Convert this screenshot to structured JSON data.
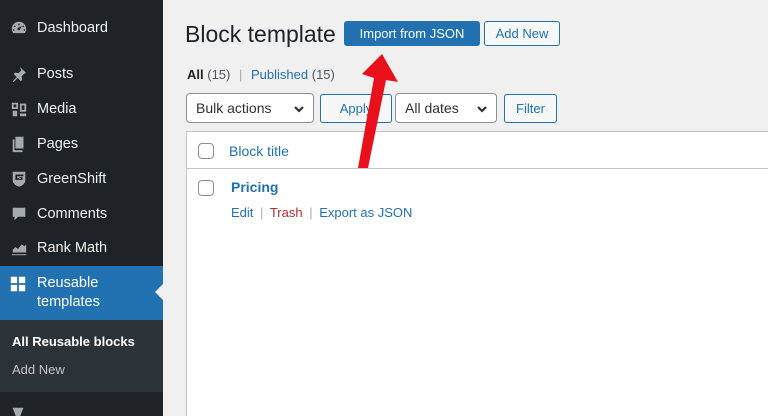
{
  "sidebar": {
    "items": [
      {
        "label": "Dashboard",
        "icon": "dashboard-icon"
      },
      {
        "label": "Posts",
        "icon": "pin-icon"
      },
      {
        "label": "Media",
        "icon": "media-icon"
      },
      {
        "label": "Pages",
        "icon": "pages-icon"
      },
      {
        "label": "GreenShift",
        "icon": "greenshift-icon"
      },
      {
        "label": "Comments",
        "icon": "comment-icon"
      },
      {
        "label": "Rank Math",
        "icon": "chart-icon"
      }
    ],
    "active": {
      "label_line1": "Reusable",
      "label_line2": "templates",
      "icon": "blocks-icon"
    },
    "submenu": {
      "current": "All Reusable blocks",
      "add_new": "Add New"
    }
  },
  "header": {
    "title": "Block template",
    "import_button": "Import from JSON",
    "add_new_button": "Add New"
  },
  "filters": {
    "all_label": "All",
    "all_count": "(15)",
    "separator": "|",
    "published_label": "Published",
    "published_count": "(15)",
    "bulk_actions": "Bulk actions",
    "apply_button": "Apply",
    "dates": "All dates",
    "filter_button": "Filter"
  },
  "table": {
    "column_title": "Block title",
    "rows": [
      {
        "title": "Pricing",
        "actions": {
          "edit": "Edit",
          "trash": "Trash",
          "export": "Export as JSON",
          "separator": "|"
        }
      }
    ]
  },
  "colors": {
    "sidebar_bg": "#1d2327",
    "accent": "#2271b1",
    "annotation_arrow": "#e8101a"
  }
}
